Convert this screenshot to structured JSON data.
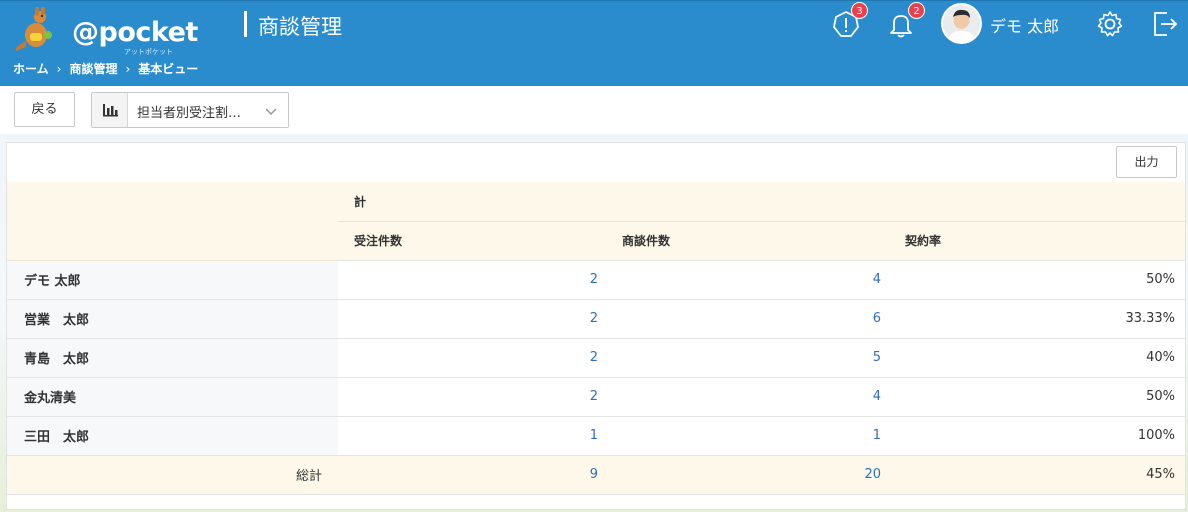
{
  "header": {
    "logo_text": "@pocket",
    "logo_sub": "アットポケット",
    "app_title": "商談管理",
    "alerts_badge": "3",
    "notifications_badge": "2",
    "user_name": "デモ 太郎",
    "colors": {
      "header_bg": "#2a8ccc",
      "badge": "#e8414d"
    }
  },
  "breadcrumb": {
    "items": [
      "ホーム",
      "商談管理",
      "基本ビュー"
    ],
    "separator": "›"
  },
  "toolbar": {
    "back_label": "戻る",
    "report_select_value": "担当者別受注割…",
    "report_icon": "bar-chart-icon"
  },
  "panel": {
    "export_label": "出力",
    "group_header": "計",
    "columns": [
      "受注件数",
      "商談件数",
      "契約率"
    ],
    "rows": [
      {
        "name": "デモ 太郎",
        "orders": "2",
        "deals": "4",
        "rate": "50%"
      },
      {
        "name": "営業　太郎",
        "orders": "2",
        "deals": "6",
        "rate": "33.33%"
      },
      {
        "name": "青島　太郎",
        "orders": "2",
        "deals": "5",
        "rate": "40%"
      },
      {
        "name": "金丸清美",
        "orders": "2",
        "deals": "4",
        "rate": "50%"
      },
      {
        "name": "三田　太郎",
        "orders": "1",
        "deals": "1",
        "rate": "100%"
      }
    ],
    "total": {
      "label": "総計",
      "orders": "9",
      "deals": "20",
      "rate": "45%"
    },
    "colors": {
      "link": "#2f6fb4",
      "header_bg": "#fdf8ea",
      "name_col_bg": "#f7f8fa"
    }
  }
}
